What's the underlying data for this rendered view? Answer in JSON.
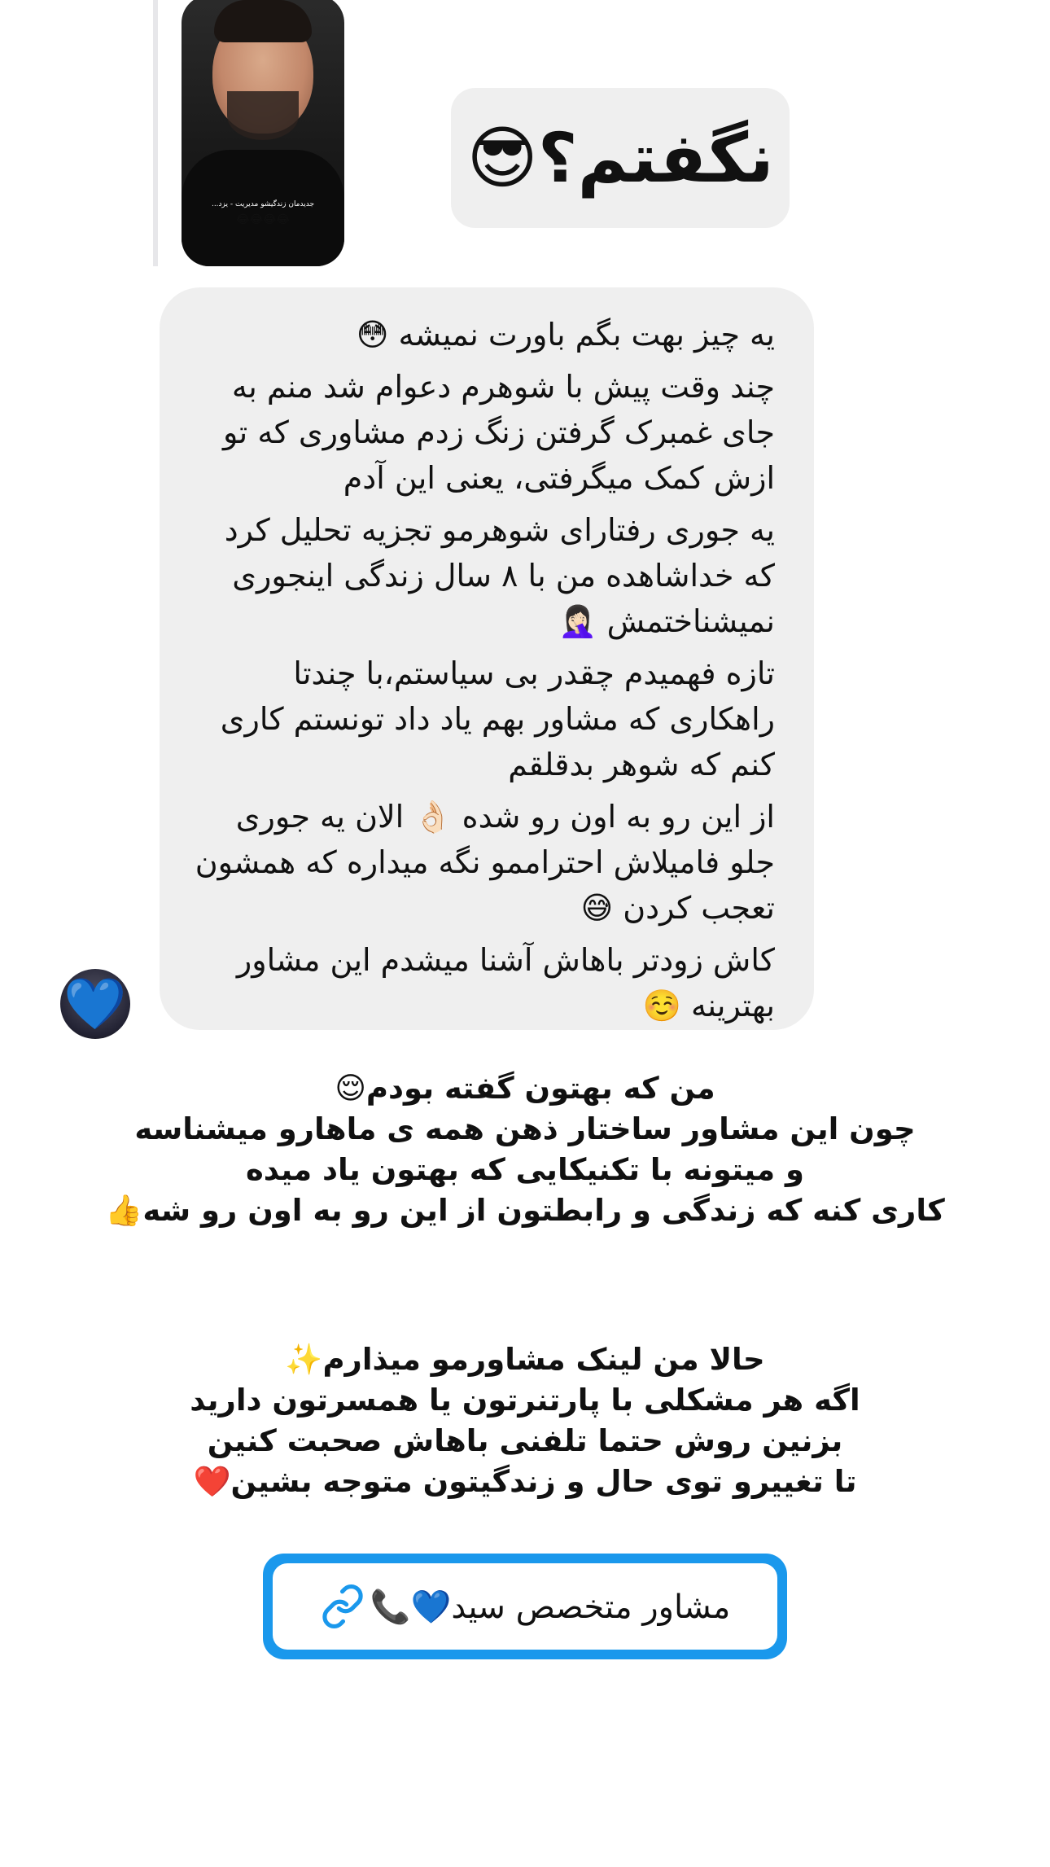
{
  "story_reply": {
    "thumb_caption": "...جدیدمان زندگیشو مدیریت - یزد",
    "thumb_emojis": "😂😂😂😂",
    "bubble_text": "نگفتم؟😎"
  },
  "message": {
    "lines": [
      "یه چیز بهت بگم باورت نمیشه 😳",
      "چند وقت پیش با شوهرم دعوام شد منم به جای غمبرک گرفتن زنگ زدم مشاوری که تو ازش کمک میگرفتی، یعنی این آدم",
      "یه جوری رفتارای شوهرمو تجزیه تحلیل کرد که خداشاهده من با ۸ سال زندگی اینجوری نمیشناختمش 🤦🏻‍♀️",
      "تازه فهمیدم چقدر بی سیاستم،با چندتا راهکاری که مشاور بهم یاد داد تونستم کاری کنم که شوهر بدقلقم",
      "از این رو به اون رو شده 👌🏻 الان یه جوری جلو فامیلاش احتراممو نگه میداره که همشون تعجب کردن 😅",
      "کاش زودتر باهاش آشنا میشدم این مشاور بهترینه ☺️"
    ],
    "avatar_emoji": "💙"
  },
  "caption1": {
    "lines": [
      "من که بهتون گفته بودم😌",
      "چون این مشاور ساختار ذهن همه ی ماهارو میشناسه",
      "و میتونه با تکنیکایی که بهتون یاد میده",
      "کاری کنه که زندگی و رابطتون از این رو به اون رو شه👍"
    ]
  },
  "caption2": {
    "lines": [
      "حالا من لینک مشاورمو میذارم✨",
      "اگه هر مشکلی با پارتنرتون یا همسرتون دارید",
      "بزنین روش حتما تلفنی باهاش صحبت کنین",
      "تا تغییرو توی حال و زندگیتون متوجه بشین❤️"
    ]
  },
  "link_button": {
    "label": "مشاور متخصص سید💙📞",
    "icon": "link-icon",
    "color": "#1a98ec"
  }
}
